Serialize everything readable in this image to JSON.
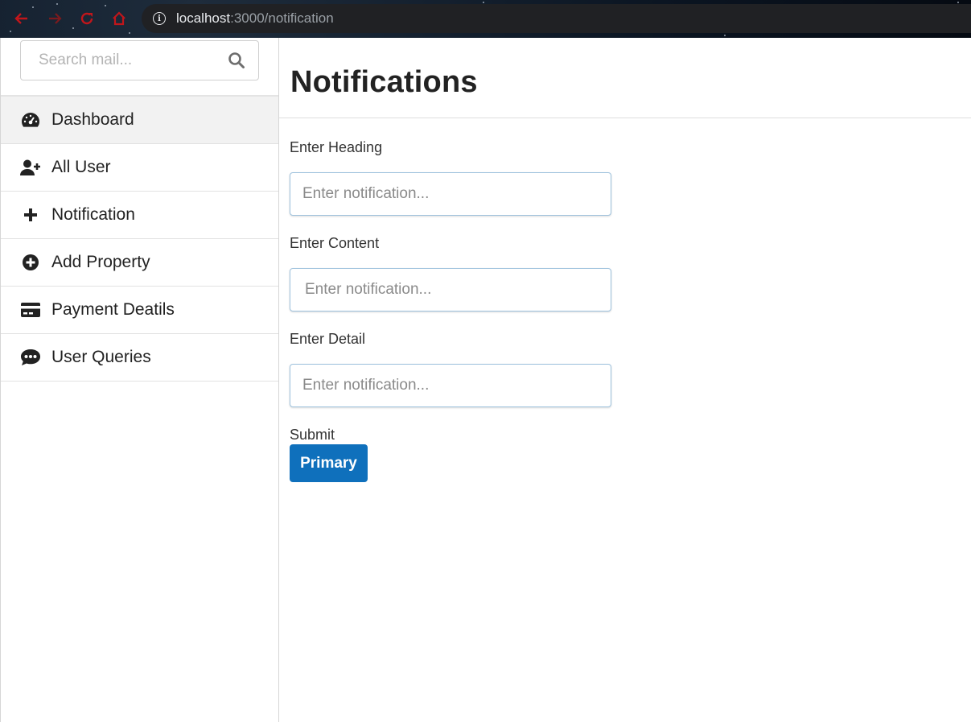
{
  "browser": {
    "url_host": "localhost",
    "url_path": ":3000/notification",
    "nav_icons": [
      "back-icon",
      "forward-icon",
      "reload-icon",
      "home-icon",
      "info-icon"
    ],
    "nav_icon_color": "#c0161b"
  },
  "sidebar": {
    "search": {
      "placeholder": "Search mail...",
      "icon": "search-icon"
    },
    "items": [
      {
        "label": "Dashboard",
        "icon": "dashboard-icon",
        "active": true
      },
      {
        "label": "All User",
        "icon": "user-plus-icon"
      },
      {
        "label": "Notification",
        "icon": "plus-icon"
      },
      {
        "label": "Add Property",
        "icon": "plus-circle-icon"
      },
      {
        "label": "Payment Deatils",
        "icon": "credit-card-icon"
      },
      {
        "label": "User Queries",
        "icon": "comment-dots-icon"
      }
    ]
  },
  "main": {
    "title": "Notifications",
    "fields": [
      {
        "label": "Enter Heading",
        "placeholder": "Enter notification...",
        "value": ""
      },
      {
        "label": "Enter Content",
        "placeholder": "Enter notification...",
        "value": ""
      },
      {
        "label": "Enter Detail",
        "placeholder": "Enter notification...",
        "value": ""
      }
    ],
    "submit_label": "Submit",
    "button_label": "Primary"
  },
  "colors": {
    "primary_button": "#0f70bc",
    "active_menu_bg": "#f2f2f2",
    "input_border": "#9ec2dd"
  }
}
